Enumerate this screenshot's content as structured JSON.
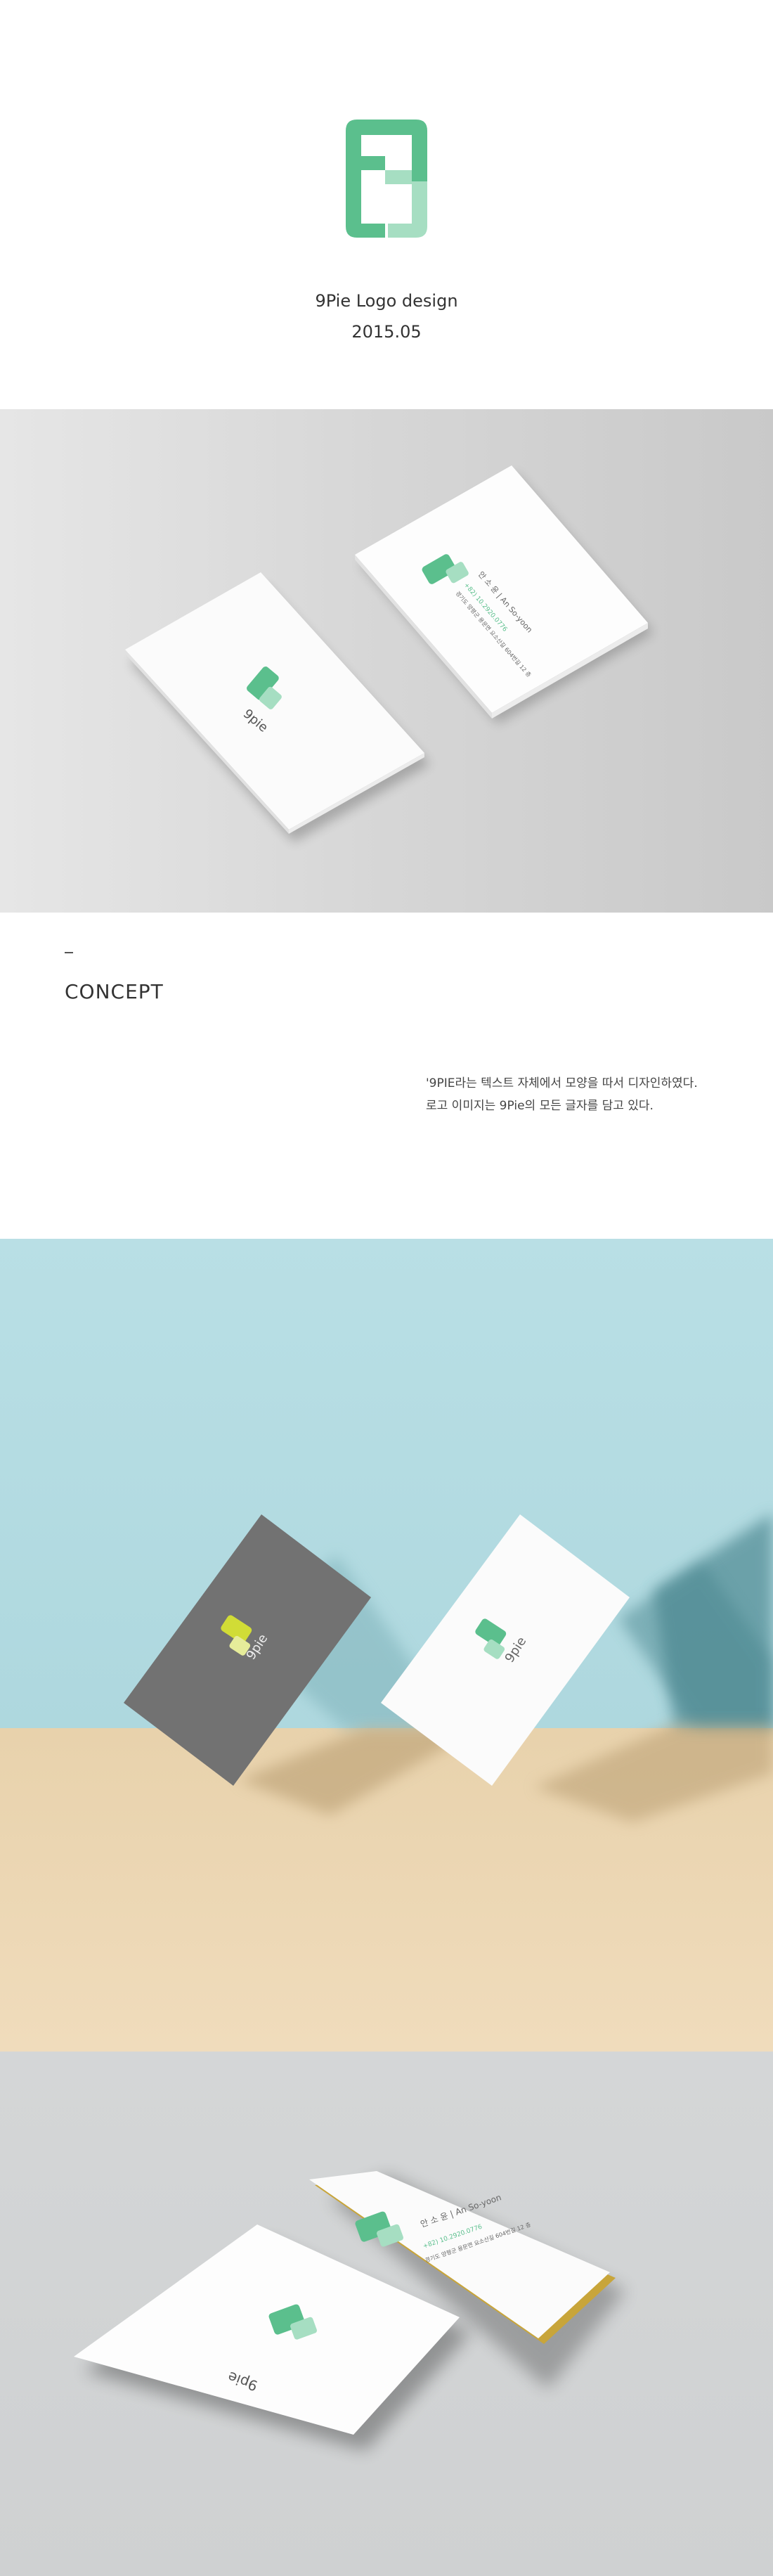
{
  "header": {
    "title": "9Pie Logo design",
    "date": "2015.05"
  },
  "colors": {
    "brand_green": "#5bbf8d",
    "brand_light_green": "#a6dec2",
    "brand_yellow": "#d1dc36",
    "dark_card": "#727272"
  },
  "concept": {
    "section_label": "CONCEPT",
    "line1": "'9PIE라는 텍스트 자체에서 모양을 따서 디자인하였다.",
    "line2": "로고 이미지는 9Pie의 모든 글자를 담고 있다."
  },
  "cards": {
    "brand_name": "9pie",
    "person_name": "안 소 윤 | An So-yoon",
    "phone": "+82) 10.2920.0776",
    "address": "경기도 양평군 용문면 요소산길 604번길 12 층"
  },
  "icons": {
    "logo": "9pie-logo-icon"
  }
}
